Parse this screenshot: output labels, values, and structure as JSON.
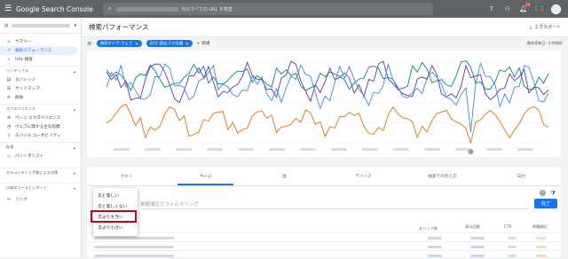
{
  "topbar": {
    "app_name": "Google Search Console",
    "search_placeholder": "内のすべての URL を検査",
    "notification_count": "39"
  },
  "sidebar": {
    "items": [
      {
        "label": "サマリー",
        "icon": "home-icon"
      },
      {
        "label": "検索パフォーマンス",
        "icon": "chart-line-icon",
        "active": true
      },
      {
        "label": "URL 検査",
        "icon": "search-icon"
      }
    ],
    "sections": [
      {
        "title": "インデックス",
        "items": [
          {
            "label": "カバレッジ",
            "icon": "coverage-icon"
          },
          {
            "label": "サイトマップ",
            "icon": "sitemap-icon"
          },
          {
            "label": "削除",
            "icon": "remove-icon"
          }
        ]
      },
      {
        "title": "エクスペリエンス",
        "items": [
          {
            "label": "ページ エクスペリエンス",
            "icon": "page-exp-icon"
          },
          {
            "label": "ウェブに関する主な指標",
            "icon": "speed-icon"
          },
          {
            "label": "モバイル ユーザビリティ",
            "icon": "mobile-icon"
          }
        ]
      },
      {
        "title": "拡張",
        "items": [
          {
            "label": "パンくずリスト",
            "icon": "breadcrumb-icon"
          }
        ]
      },
      {
        "title": "セキュリティと手動による対策",
        "items": []
      },
      {
        "title": "以前のツールとレポート",
        "items": []
      },
      {
        "title": "",
        "items": [
          {
            "label": "リンク",
            "icon": "link-icon"
          }
        ]
      }
    ]
  },
  "header": {
    "title": "検索パフォーマンス",
    "export_label": "エクスポート"
  },
  "filters": {
    "chips": [
      "検索タイプ: ウェブ",
      "日付: 過去 3 か月間"
    ],
    "new_label": "新規",
    "last_updated": "最終更新日: 4 時間前"
  },
  "tabs": [
    "クエリ",
    "ページ",
    "国",
    "デバイス",
    "検索での見え方",
    "日付"
  ],
  "table_filter": {
    "placeholder": "掲載順位でフィルタリング",
    "done_label": "完了"
  },
  "table_headers": {
    "clicks": "クリック数",
    "impressions": "表示回数",
    "ctr": "CTR",
    "position": "掲載順位"
  },
  "dropdown": {
    "options": [
      "次と等しい",
      "次と等しくない",
      "次より大きい",
      "次より小さい"
    ],
    "highlighted": "次より大きい"
  },
  "colors": {
    "accent": "#1a73e8",
    "clicks_line": "#4285f4",
    "impressions_line": "#5e35b1",
    "ctr_line": "#00897b",
    "position_line": "#e8710a",
    "highlight_border": "#c5001a"
  },
  "chart_data": {
    "type": "line",
    "series": [],
    "grid": true
  }
}
